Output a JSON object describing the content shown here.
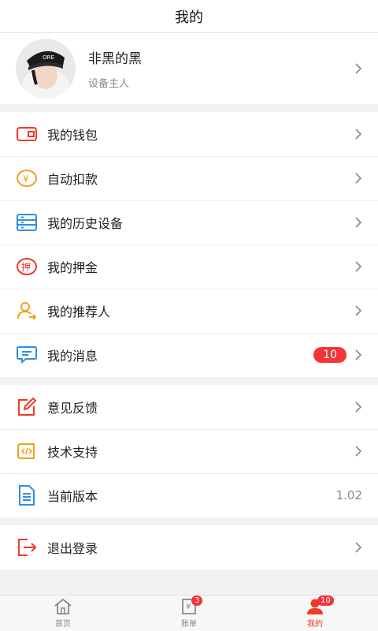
{
  "header": {
    "title": "我的"
  },
  "profile": {
    "name": "非黑的黑",
    "role": "设备主人"
  },
  "menu_group1": [
    {
      "label": "我的钱包",
      "icon": "wallet-icon"
    },
    {
      "label": "自动扣款",
      "icon": "yuan-coin-icon"
    },
    {
      "label": "我的历史设备",
      "icon": "list-icon"
    },
    {
      "label": "我的押金",
      "icon": "deposit-icon"
    },
    {
      "label": "我的推荐人",
      "icon": "referrer-icon"
    },
    {
      "label": "我的消息",
      "icon": "message-icon",
      "badge": "10"
    }
  ],
  "menu_group2": [
    {
      "label": "意见反馈",
      "icon": "feedback-icon"
    },
    {
      "label": "技术支持",
      "icon": "code-icon"
    },
    {
      "label": "当前版本",
      "icon": "document-icon",
      "value": "1.02"
    }
  ],
  "menu_group3": [
    {
      "label": "退出登录",
      "icon": "logout-icon"
    }
  ],
  "tabbar": {
    "tabs": [
      {
        "label": "首页",
        "icon": "home-icon"
      },
      {
        "label": "账单",
        "icon": "bill-icon",
        "badge": "3"
      },
      {
        "label": "我的",
        "icon": "user-icon",
        "badge": "10",
        "active": true
      }
    ]
  },
  "colors": {
    "accent": "#f03a28",
    "badge": "#f2353a",
    "blue": "#2f8fe0",
    "orange": "#f0a020"
  }
}
